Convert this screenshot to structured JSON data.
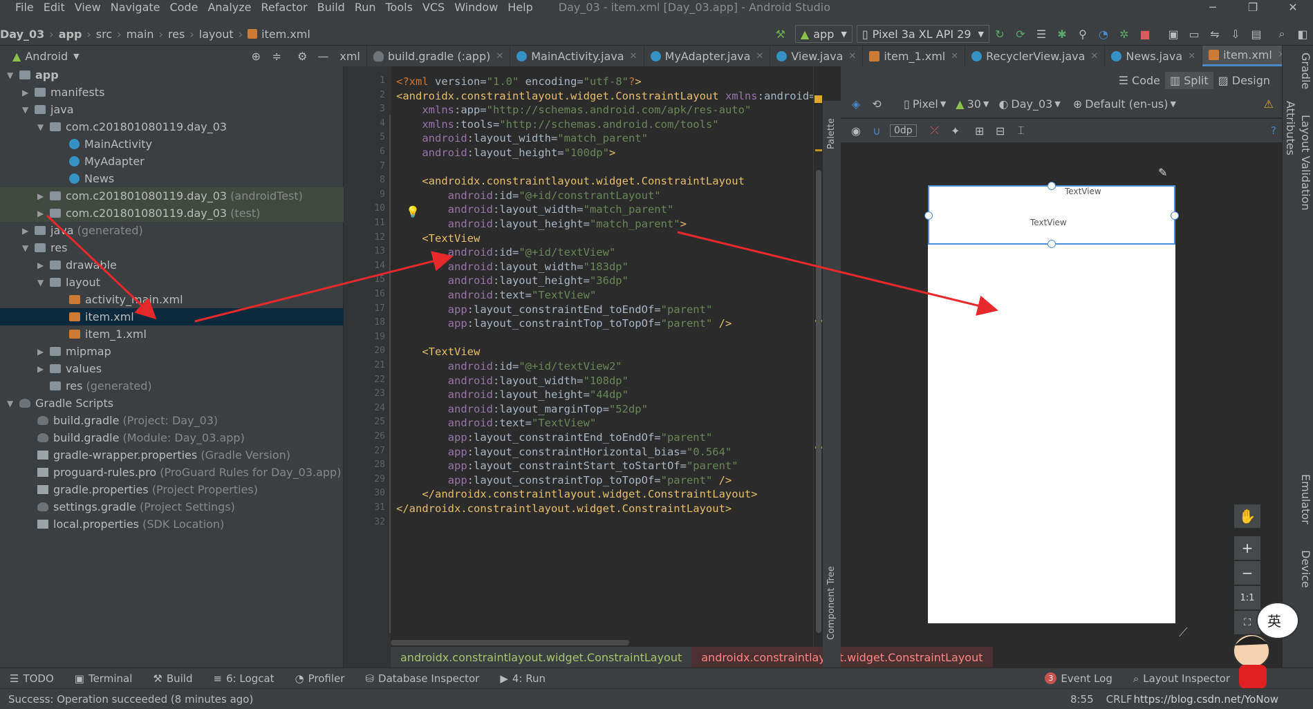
{
  "menu": [
    "File",
    "Edit",
    "View",
    "Navigate",
    "Code",
    "Analyze",
    "Refactor",
    "Build",
    "Run",
    "Tools",
    "VCS",
    "Window",
    "Help"
  ],
  "window_title": "Day_03 - item.xml [Day_03.app] - Android Studio",
  "breadcrumb": [
    "Day_03",
    "app",
    "src",
    "main",
    "res",
    "layout",
    "item.xml"
  ],
  "toolbar": {
    "config": "app",
    "device": "Pixel 3a XL API 29"
  },
  "project_view": "Android",
  "tabs": [
    {
      "label": "xml",
      "active": false
    },
    {
      "label": "build.gradle (:app)",
      "active": false
    },
    {
      "label": "MainActivity.java",
      "active": false
    },
    {
      "label": "MyAdapter.java",
      "active": false
    },
    {
      "label": "View.java",
      "active": false
    },
    {
      "label": "item_1.xml",
      "active": false
    },
    {
      "label": "RecyclerView.java",
      "active": false
    },
    {
      "label": "News.java",
      "active": false
    },
    {
      "label": "item.xml",
      "active": true
    }
  ],
  "tree": [
    {
      "label": "app",
      "extra": ""
    },
    {
      "label": "manifests",
      "extra": ""
    },
    {
      "label": "java",
      "extra": ""
    },
    {
      "label": "com.c201801080119.day_03",
      "extra": ""
    },
    {
      "label": "MainActivity",
      "extra": ""
    },
    {
      "label": "MyAdapter",
      "extra": ""
    },
    {
      "label": "News",
      "extra": ""
    },
    {
      "label": "com.c201801080119.day_03",
      "extra": "(androidTest)"
    },
    {
      "label": "com.c201801080119.day_03",
      "extra": "(test)"
    },
    {
      "label": "java",
      "extra": "(generated)"
    },
    {
      "label": "res",
      "extra": ""
    },
    {
      "label": "drawable",
      "extra": ""
    },
    {
      "label": "layout",
      "extra": ""
    },
    {
      "label": "activity_main.xml",
      "extra": ""
    },
    {
      "label": "item.xml",
      "extra": ""
    },
    {
      "label": "item_1.xml",
      "extra": ""
    },
    {
      "label": "mipmap",
      "extra": ""
    },
    {
      "label": "values",
      "extra": ""
    },
    {
      "label": "res",
      "extra": "(generated)"
    },
    {
      "label": "Gradle Scripts",
      "extra": ""
    },
    {
      "label": "build.gradle",
      "extra": "(Project: Day_03)"
    },
    {
      "label": "build.gradle",
      "extra": "(Module: Day_03.app)"
    },
    {
      "label": "gradle-wrapper.properties",
      "extra": "(Gradle Version)"
    },
    {
      "label": "proguard-rules.pro",
      "extra": "(ProGuard Rules for Day_03.app)"
    },
    {
      "label": "gradle.properties",
      "extra": "(Project Properties)"
    },
    {
      "label": "settings.gradle",
      "extra": "(Project Settings)"
    },
    {
      "label": "local.properties",
      "extra": "(SDK Location)"
    }
  ],
  "code_lines": [
    "<?xml version=\"1.0\" encoding=\"utf-8\"?>",
    "<androidx.constraintlayout.widget.ConstraintLayout xmlns:android=\"ht",
    "    xmlns:app=\"http://schemas.android.com/apk/res-auto\"",
    "    xmlns:tools=\"http://schemas.android.com/tools\"",
    "    android:layout_width=\"match_parent\"",
    "    android:layout_height=\"100dp\">",
    "",
    "    <androidx.constraintlayout.widget.ConstraintLayout",
    "        android:id=\"@+id/constrantLayout\"",
    "        android:layout_width=\"match_parent\"",
    "        android:layout_height=\"match_parent\">",
    "    <TextView",
    "        android:id=\"@+id/textView\"",
    "        android:layout_width=\"183dp\"",
    "        android:layout_height=\"36dp\"",
    "        android:text=\"TextView\"",
    "        app:layout_constraintEnd_toEndOf=\"parent\"",
    "        app:layout_constraintTop_toTopOf=\"parent\" />",
    "",
    "    <TextView",
    "        android:id=\"@+id/textView2\"",
    "        android:layout_width=\"108dp\"",
    "        android:layout_height=\"44dp\"",
    "        android:layout_marginTop=\"52dp\"",
    "        android:text=\"TextView\"",
    "        app:layout_constraintEnd_toEndOf=\"parent\"",
    "        app:layout_constraintHorizontal_bias=\"0.564\"",
    "        app:layout_constraintStart_toStartOf=\"parent\"",
    "        app:layout_constraintTop_toTopOf=\"parent\" />",
    "    </androidx.constraintlayout.widget.ConstraintLayout>",
    "</androidx.constraintlayout.widget.ConstraintLayout>",
    ""
  ],
  "view_modes": {
    "code": "Code",
    "split": "Split",
    "design": "Design"
  },
  "design_toolbar": {
    "device": "Pixel",
    "api": "30",
    "theme": "Day_03",
    "locale": "Default (en-us)",
    "margin": "0dp"
  },
  "preview": {
    "text1": "TextView",
    "text2": "TextView"
  },
  "side_labels": {
    "palette": "Palette",
    "component_tree": "Component Tree",
    "attributes": "Attributes",
    "gradle": "Gradle",
    "layout_validation": "Layout Validation",
    "emulator": "Emulator",
    "device": "Device"
  },
  "code_breadcrumb": [
    "androidx.constraintlayout.widget.ConstraintLayout",
    "androidx.constraintlayout.widget.ConstraintLayout"
  ],
  "bottom_tools": [
    "TODO",
    "Terminal",
    "Build",
    "6: Logcat",
    "Profiler",
    "Database Inspector",
    "4: Run"
  ],
  "right_tools": {
    "event_log": "Event Log",
    "event_count": "3",
    "layout_inspector": "Layout Inspector"
  },
  "status": {
    "message": "Success: Operation succeeded (8 minutes ago)",
    "position": "8:55",
    "encoding": "CRLF",
    "watermark": "https://blog.csdn.net/YoNow"
  },
  "zoom": {
    "fit": "1:1"
  },
  "colors": {
    "accent": "#4a88c7",
    "arrow": "#e8292c"
  }
}
